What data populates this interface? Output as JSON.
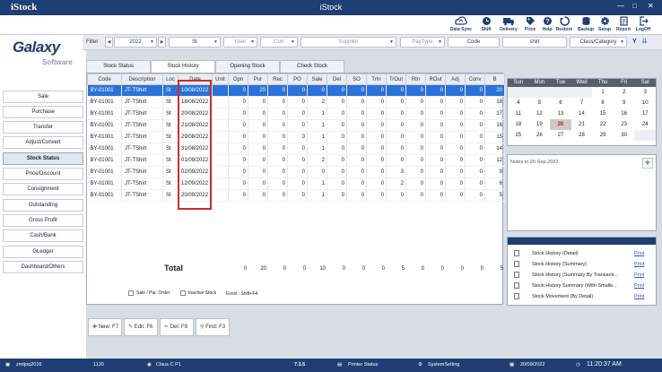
{
  "app": {
    "name": "iStock",
    "title": "iStock"
  },
  "window": {
    "min": "—",
    "max": "□",
    "close": "✕"
  },
  "toolbar": [
    {
      "label": "Data Sync",
      "icon": "cloud-sync-icon"
    },
    {
      "label": "Shift",
      "icon": "clock-icon"
    },
    {
      "label": "Delivery",
      "icon": "truck-icon"
    },
    {
      "label": "Price",
      "icon": "tag-icon"
    },
    {
      "label": "Help",
      "icon": "help-icon"
    },
    {
      "label": "Restore",
      "icon": "restore-icon"
    },
    {
      "label": "Backup",
      "icon": "database-icon"
    },
    {
      "label": "Setup",
      "icon": "gear-icon"
    },
    {
      "label": "Report",
      "icon": "report-icon"
    },
    {
      "label": "LogOff",
      "icon": "logoff-icon"
    }
  ],
  "logo": {
    "main": "Galaxy",
    "sub": "Software"
  },
  "filter": {
    "label": "Filter",
    "year": "2022",
    "loc": "St",
    "user_ph": "User",
    "curr_ph": "Curr",
    "supplier_ph": "Supplier",
    "paytype_ph": "PayType",
    "code": "Code",
    "search": "shirt",
    "category_ph": "Class/Category",
    "y_btn": "Y"
  },
  "sidebar": [
    {
      "label": "Sale"
    },
    {
      "label": "Purchase"
    },
    {
      "label": "Transfer"
    },
    {
      "label": "Adjust/Convert"
    },
    {
      "label": "Stock Status",
      "active": true
    },
    {
      "label": "Price/Discount"
    },
    {
      "label": "Consignment"
    },
    {
      "label": "Outstanding"
    },
    {
      "label": "Gross Profit"
    },
    {
      "label": "Cash/Bank"
    },
    {
      "label": "GLedger"
    },
    {
      "label": "Dashboard/Others"
    }
  ],
  "tabs": [
    {
      "label": "Stock Status"
    },
    {
      "label": "Stock History",
      "active": true
    },
    {
      "label": "Opening Stock"
    },
    {
      "label": "Check Stock"
    }
  ],
  "grid": {
    "columns": [
      "Code",
      "Description",
      "Loc",
      "Date",
      "Unit",
      "Opn",
      "Pur",
      "Rec",
      "PO",
      "Sale",
      "Del",
      "SO",
      "TrIn",
      "TrOut",
      "Rtn",
      "ROut",
      "Adj",
      "Conv",
      "B"
    ],
    "rows": [
      [
        "BY-01001",
        "JT-TShirt",
        "St",
        "10/08/2022",
        "",
        "0",
        "20",
        "0",
        "0",
        "0",
        "0",
        "0",
        "0",
        "0",
        "0",
        "0",
        "0",
        "0",
        "20"
      ],
      [
        "BY-01001",
        "JT-TShirt",
        "St",
        "18/08/2022",
        "",
        "0",
        "0",
        "0",
        "0",
        "2",
        "0",
        "0",
        "0",
        "0",
        "0",
        "0",
        "0",
        "0",
        "18"
      ],
      [
        "BY-01001",
        "JT-TShirt",
        "St",
        "20/08/2022",
        "",
        "0",
        "0",
        "0",
        "0",
        "1",
        "0",
        "0",
        "0",
        "0",
        "0",
        "0",
        "0",
        "0",
        "17"
      ],
      [
        "BY-01001",
        "JT-TShirt",
        "St",
        "21/08/2022",
        "",
        "0",
        "0",
        "0",
        "0",
        "1",
        "0",
        "0",
        "0",
        "0",
        "0",
        "0",
        "0",
        "0",
        "16"
      ],
      [
        "BY-01001",
        "JT-TShirt",
        "St",
        "29/08/2022",
        "",
        "0",
        "0",
        "0",
        "0",
        "1",
        "0",
        "0",
        "0",
        "0",
        "0",
        "0",
        "0",
        "0",
        "15"
      ],
      [
        "BY-01001",
        "JT-TShirt",
        "St",
        "31/08/2022",
        "",
        "0",
        "0",
        "0",
        "0",
        "1",
        "0",
        "0",
        "0",
        "0",
        "0",
        "0",
        "0",
        "0",
        "14"
      ],
      [
        "BY-01001",
        "JT-TShirt",
        "St",
        "01/09/2022",
        "",
        "0",
        "0",
        "0",
        "0",
        "2",
        "0",
        "0",
        "0",
        "0",
        "0",
        "0",
        "0",
        "0",
        "12"
      ],
      [
        "BY-01001",
        "JT-TShirt",
        "St",
        "02/09/2022",
        "",
        "0",
        "0",
        "0",
        "0",
        "0",
        "0",
        "0",
        "0",
        "3",
        "0",
        "0",
        "0",
        "0",
        "9"
      ],
      [
        "BY-01001",
        "JT-TShirt",
        "St",
        "12/09/2022",
        "",
        "0",
        "0",
        "0",
        "0",
        "1",
        "0",
        "0",
        "0",
        "2",
        "0",
        "0",
        "0",
        "0",
        "6"
      ],
      [
        "BY-01001",
        "JT-TShirt",
        "St",
        "20/09/2022",
        "",
        "0",
        "0",
        "0",
        "0",
        "1",
        "0",
        "0",
        "0",
        "0",
        "0",
        "0",
        "0",
        "0",
        "5"
      ]
    ],
    "total_label": "Total",
    "totals": [
      "0",
      "20",
      "0",
      "0",
      "10",
      "0",
      "0",
      "0",
      "5",
      "0",
      "0",
      "0",
      "0",
      "5"
    ]
  },
  "options": {
    "sale_pur_order": "Sale / Pur. Order",
    "inactive_stock": "Inactive Stock",
    "excel_hint": "Excel : Shift+F4"
  },
  "actions": [
    {
      "label": "New: F7",
      "icon": "plus-icon"
    },
    {
      "label": "Edit: F6",
      "icon": "edit-icon"
    },
    {
      "label": "Del: F8",
      "icon": "delete-icon"
    },
    {
      "label": "Find: F3",
      "icon": "search-icon"
    }
  ],
  "calendar": {
    "days": [
      "Sun",
      "Mon",
      "Tue",
      "Wed",
      "Thu",
      "Fri",
      "Sat"
    ],
    "weeks": [
      [
        "",
        "",
        "",
        "",
        "1",
        "2",
        "3"
      ],
      [
        "4",
        "5",
        "6",
        "7",
        "8",
        "9",
        "10"
      ],
      [
        "11",
        "12",
        "13",
        "14",
        "15",
        "16",
        "17"
      ],
      [
        "18",
        "19",
        "20",
        "21",
        "22",
        "23",
        "24"
      ],
      [
        "25",
        "26",
        "27",
        "28",
        "29",
        "30",
        ""
      ]
    ],
    "today": "20"
  },
  "notes": {
    "title": "Notes in 20-Sep-2022",
    "add": "+"
  },
  "reports": [
    {
      "label": "Stock History (Detail)",
      "action": "Print"
    },
    {
      "label": "Stock History (Summary)",
      "action": "Print"
    },
    {
      "label": "Stock History (Summary By Transacti...",
      "action": "Print"
    },
    {
      "label": "Stock History Summary (With Smalle...",
      "action": "Print"
    },
    {
      "label": "Stock Movement (By Detail)",
      "action": "Print"
    }
  ],
  "status": {
    "user": "zmtjoq2016",
    "code": "1120",
    "client": "Claus C P1",
    "version": "7.3.5",
    "printer": "Printer Status",
    "system": "SystemSetting",
    "date": "20/09/2022",
    "time": "11:20:37 AM"
  }
}
